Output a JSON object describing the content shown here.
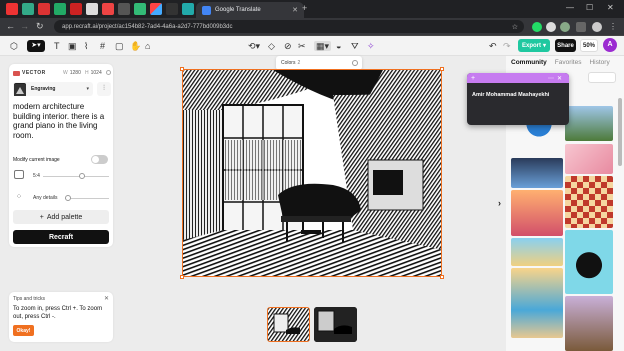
{
  "browser": {
    "active_tab_title": "Google Translate",
    "url": "app.recraft.ai/project/ac154b82-7ad4-4a6a-a2d7-777bd009b3dc",
    "tab_icons": [
      "red-icon",
      "green-icon",
      "red-icon",
      "green-icon",
      "red-icon",
      "white-icon",
      "red-icon",
      "dark-icon",
      "green-icon",
      "dark-icon",
      "colorful-icon",
      "dark-icon",
      "teal-icon"
    ]
  },
  "toolbar": {
    "export_label": "Export",
    "share_label": "Share",
    "zoom_level": "50%",
    "avatar_letter": "A"
  },
  "colors_popover": {
    "label": "Colors",
    "count": "2"
  },
  "left_panel": {
    "section_title": "VECTOR",
    "width_label": "W",
    "width_value": "1280",
    "height_label": "H",
    "height_value": "1024",
    "style_name": "Engraving",
    "prompt": "modern architecture building interior. there is a grand piano in the living room.",
    "modify_label": "Modify current image",
    "aspect_ratio": "5:4",
    "details_label": "Any details",
    "add_palette_label": "Add palette",
    "recraft_label": "Recraft"
  },
  "tips": {
    "header": "Tips and tricks",
    "body": "To zoom in, press Ctrl +. To zoom out, press Ctrl -.",
    "ok_label": "Okay!"
  },
  "right_panel": {
    "tabs": [
      "Community",
      "Favorites",
      "History"
    ],
    "active_tab": "Community"
  },
  "popup": {
    "name": "Amir Mohammad Mashayekhi"
  },
  "colors": {
    "accent_orange": "#f07020",
    "export_green": "#1fc8a0",
    "popup_purple": "#c67bf0",
    "avatar_purple": "#9b2bd1"
  }
}
